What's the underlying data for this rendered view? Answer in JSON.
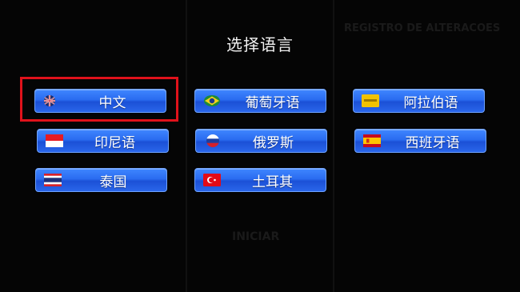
{
  "header": {
    "title": "选择语言"
  },
  "background": {
    "ghost_right": "REGISTRO DE ALTERACOES",
    "ghost_center": "INICIAR"
  },
  "languages": [
    {
      "label": "中文",
      "flag_icon": "australia-flag-icon",
      "selected": true
    },
    {
      "label": "葡萄牙语",
      "flag_icon": "brazil-flag-icon",
      "selected": false
    },
    {
      "label": "阿拉伯语",
      "flag_icon": "arabic-flag-icon",
      "selected": false
    },
    {
      "label": "印尼语",
      "flag_icon": "indonesia-flag-icon",
      "selected": false
    },
    {
      "label": "俄罗斯",
      "flag_icon": "russia-flag-icon",
      "selected": false
    },
    {
      "label": "西班牙语",
      "flag_icon": "spain-flag-icon",
      "selected": false
    },
    {
      "label": "泰国",
      "flag_icon": "thailand-flag-icon",
      "selected": false
    },
    {
      "label": "土耳其",
      "flag_icon": "turkey-flag-icon",
      "selected": false
    }
  ],
  "colors": {
    "button": "#2a6cf0",
    "selection": "#e0121b",
    "background": "#050505"
  }
}
